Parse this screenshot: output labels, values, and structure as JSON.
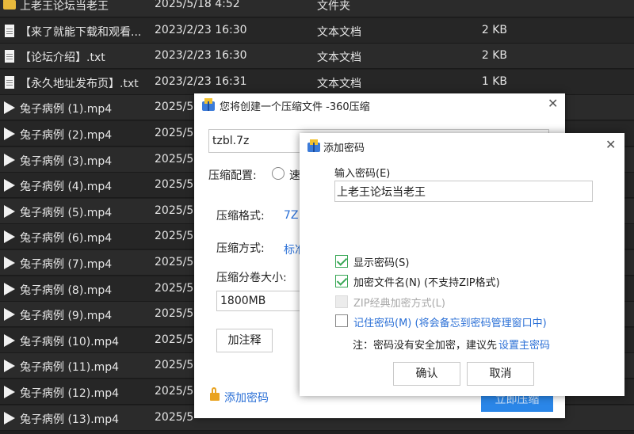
{
  "files": [
    {
      "icon": "folder-icon",
      "name": "上老王论坛当老王",
      "date": "2025/5/18 4:52",
      "type": "文件夹",
      "size": ""
    },
    {
      "icon": "text-file-icon",
      "name": "【来了就能下载和观看...",
      "date": "2023/2/23 16:30",
      "type": "文本文档",
      "size": "2 KB"
    },
    {
      "icon": "text-file-icon",
      "name": "【论坛介绍】.txt",
      "date": "2023/2/23 16:30",
      "type": "文本文档",
      "size": "2 KB"
    },
    {
      "icon": "text-file-icon",
      "name": "【永久地址发布页】.txt",
      "date": "2023/2/23 16:31",
      "type": "文本文档",
      "size": "1 KB"
    },
    {
      "icon": "video-file-icon",
      "name": "兔子病例 (1).mp4",
      "date": "2025/5",
      "type": "",
      "size": ""
    },
    {
      "icon": "video-file-icon",
      "name": "兔子病例 (2).mp4",
      "date": "2025/5",
      "type": "",
      "size": ""
    },
    {
      "icon": "video-file-icon",
      "name": "兔子病例 (3).mp4",
      "date": "2025/5",
      "type": "",
      "size": ""
    },
    {
      "icon": "video-file-icon",
      "name": "兔子病例 (4).mp4",
      "date": "2025/5",
      "type": "",
      "size": ""
    },
    {
      "icon": "video-file-icon",
      "name": "兔子病例 (5).mp4",
      "date": "2025/5",
      "type": "",
      "size": ""
    },
    {
      "icon": "video-file-icon",
      "name": "兔子病例 (6).mp4",
      "date": "2025/5",
      "type": "",
      "size": ""
    },
    {
      "icon": "video-file-icon",
      "name": "兔子病例 (7).mp4",
      "date": "2025/5",
      "type": "",
      "size": ""
    },
    {
      "icon": "video-file-icon",
      "name": "兔子病例 (8).mp4",
      "date": "2025/5",
      "type": "",
      "size": ""
    },
    {
      "icon": "video-file-icon",
      "name": "兔子病例 (9).mp4",
      "date": "2025/5",
      "type": "",
      "size": ""
    },
    {
      "icon": "video-file-icon",
      "name": "兔子病例 (10).mp4",
      "date": "2025/5",
      "type": "",
      "size": ""
    },
    {
      "icon": "video-file-icon",
      "name": "兔子病例 (11).mp4",
      "date": "2025/5",
      "type": "",
      "size": ""
    },
    {
      "icon": "video-file-icon",
      "name": "兔子病例 (12).mp4",
      "date": "2025/5",
      "type": "",
      "size": ""
    },
    {
      "icon": "video-file-icon",
      "name": "兔子病例 (13).mp4",
      "date": "2025/5",
      "type": "",
      "size": ""
    }
  ],
  "compress_dialog": {
    "title": "您将创建一个压缩文件 -360压缩",
    "filename": "tzbl.7z",
    "config_label": "压缩配置:",
    "config_option": "速",
    "format_label": "压缩格式:",
    "format_value": "7Z",
    "method_label": "压缩方式:",
    "method_value": "标准",
    "volume_label": "压缩分卷大小:",
    "volume_value": "1800MB",
    "comment_button": "加注释",
    "add_password_link": "添加密码",
    "start_button": "立即压缩"
  },
  "password_dialog": {
    "title": "添加密码",
    "input_label": "输入密码(E)",
    "password_value": "上老王论坛当老王",
    "show_password": {
      "label": "显示密码(S)",
      "checked": true
    },
    "encrypt_filenames": {
      "label": "加密文件名(N) (不支持ZIP格式)",
      "checked": true
    },
    "zip_classic": {
      "label": "ZIP经典加密方式(L)",
      "checked": false,
      "disabled": true
    },
    "remember_password": {
      "label": "记住密码(M) (将会备忘到密码管理窗口中)",
      "checked": false
    },
    "note": "注：密码没有安全加密，建议先",
    "note_link": "设置主密码",
    "ok_button": "确认",
    "cancel_button": "取消"
  },
  "colors": {
    "accent_blue": "#2a6fd6",
    "check_green": "#3aa857",
    "list_bg": "#2b2b2b"
  }
}
